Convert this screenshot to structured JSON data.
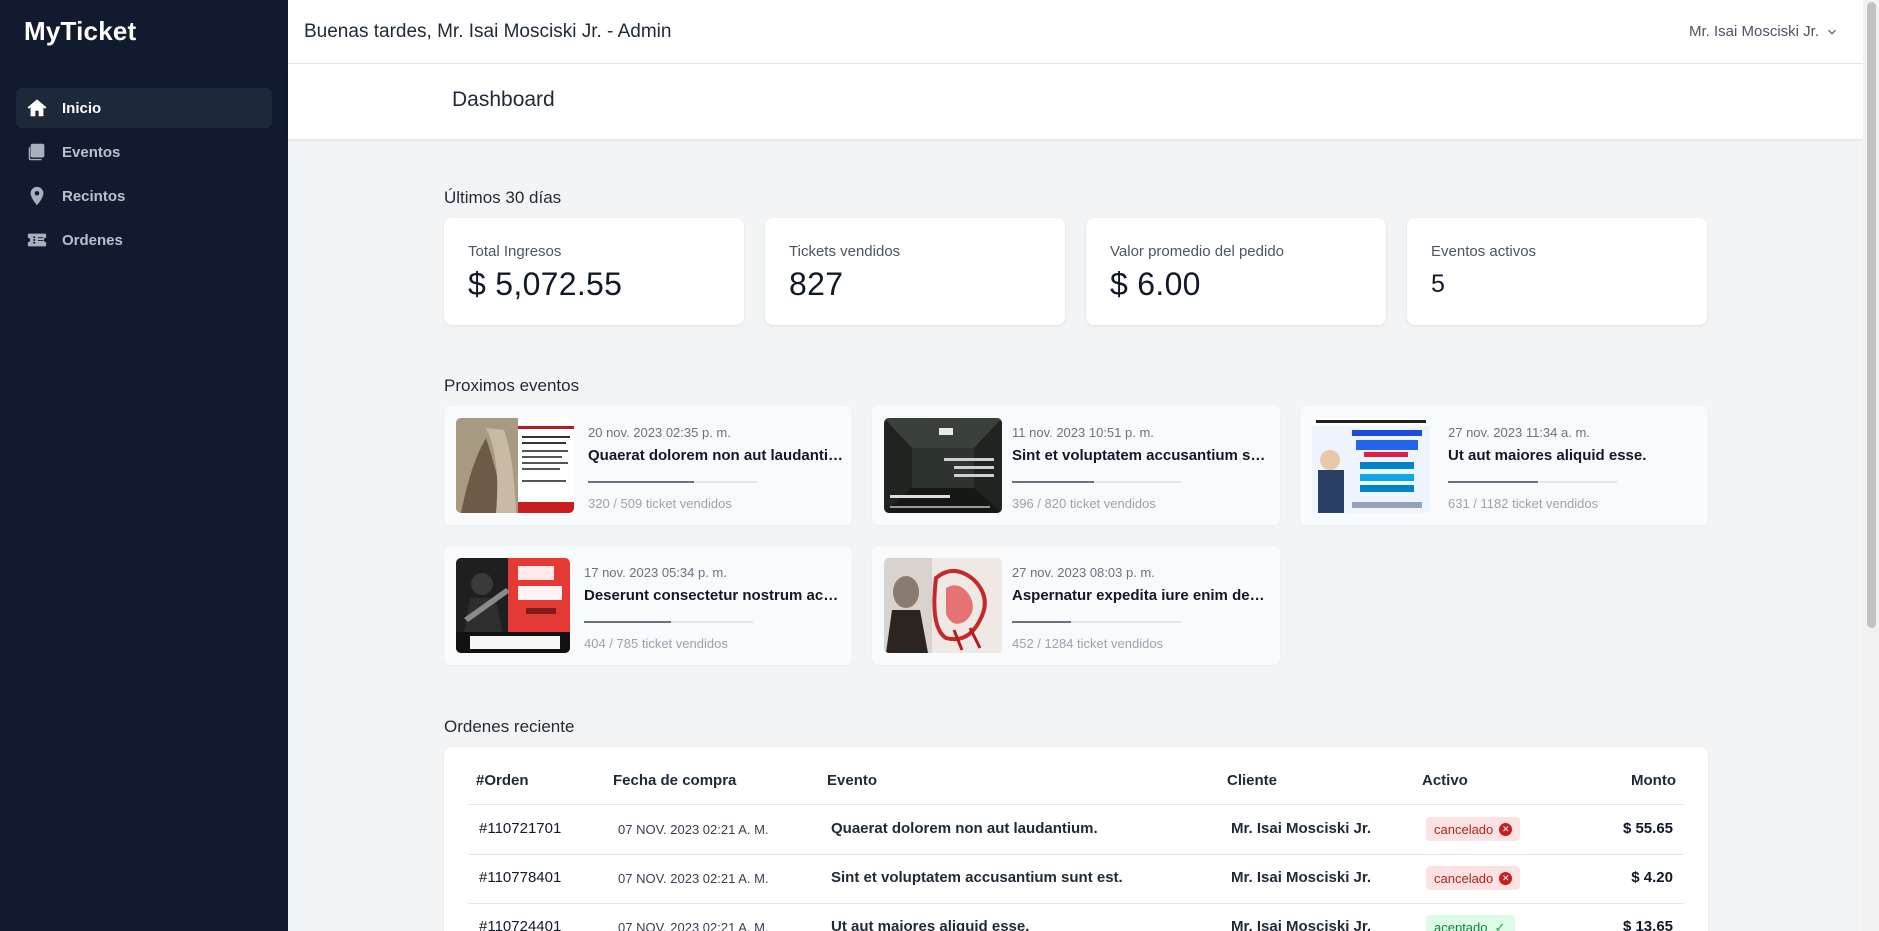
{
  "app": {
    "name": "MyTicket"
  },
  "sidebar": {
    "items": [
      {
        "label": "Inicio",
        "icon": "home-icon",
        "active": true
      },
      {
        "label": "Eventos",
        "icon": "copy-icon",
        "active": false
      },
      {
        "label": "Recintos",
        "icon": "location-pin-icon",
        "active": false
      },
      {
        "label": "Ordenes",
        "icon": "ticket-icon",
        "active": false
      }
    ]
  },
  "header": {
    "greeting": "Buenas tardes, Mr. Isai Mosciski Jr. - Admin",
    "user_name": "Mr. Isai Mosciski Jr."
  },
  "page": {
    "title": "Dashboard"
  },
  "stats": {
    "section_title": "Últimos 30 días",
    "items": [
      {
        "label": "Total Ingresos",
        "value": "$ 5,072.55"
      },
      {
        "label": "Tickets vendidos",
        "value": "827"
      },
      {
        "label": "Valor promedio del pedido",
        "value": "$ 6.00"
      },
      {
        "label": "Eventos activos",
        "value": "5"
      }
    ]
  },
  "events": {
    "section_title": "Proximos eventos",
    "items": [
      {
        "date": "20 nov. 2023 02:35 p. m.",
        "title": "Quaerat dolorem non aut laudantium.",
        "sold_text": "320 / 509 ticket vendidos",
        "progress": 0.629
      },
      {
        "date": "11 nov. 2023 10:51 p. m.",
        "title": "Sint et voluptatem accusantium sunt est.",
        "sold_text": "396 / 820 ticket vendidos",
        "progress": 0.483
      },
      {
        "date": "27 nov. 2023 11:34 a. m.",
        "title": "Ut aut maiores aliquid esse.",
        "sold_text": "631 / 1182 ticket vendidos",
        "progress": 0.534
      },
      {
        "date": "17 nov. 2023 05:34 p. m.",
        "title": "Deserunt consectetur nostrum accusantium.",
        "sold_text": "404 / 785 ticket vendidos",
        "progress": 0.515
      },
      {
        "date": "27 nov. 2023 08:03 p. m.",
        "title": "Aspernatur expedita iure enim deserunt.",
        "sold_text": "452 / 1284 ticket vendidos",
        "progress": 0.352
      }
    ]
  },
  "orders": {
    "section_title": "Ordenes reciente",
    "columns": [
      "#Orden",
      "Fecha de compra",
      "Evento",
      "Cliente",
      "Activo",
      "Monto"
    ],
    "rows": [
      {
        "id": "#110721701",
        "date": "07 NOV. 2023 02:21 A. M.",
        "event": "Quaerat dolorem non aut laudantium.",
        "client": "Mr. Isai Mosciski Jr.",
        "status": "cancelado",
        "amount": "$ 55.65"
      },
      {
        "id": "#110778401",
        "date": "07 NOV. 2023 02:21 A. M.",
        "event": "Sint et voluptatem accusantium sunt est.",
        "client": "Mr. Isai Mosciski Jr.",
        "status": "cancelado",
        "amount": "$ 4.20"
      },
      {
        "id": "#110724401",
        "date": "07 NOV. 2023 02:21 A. M.",
        "event": "Ut aut maiores aliquid esse.",
        "client": "Mr. Isai Mosciski Jr.",
        "status": "aceptado",
        "amount": "$ 13.65"
      }
    ]
  }
}
